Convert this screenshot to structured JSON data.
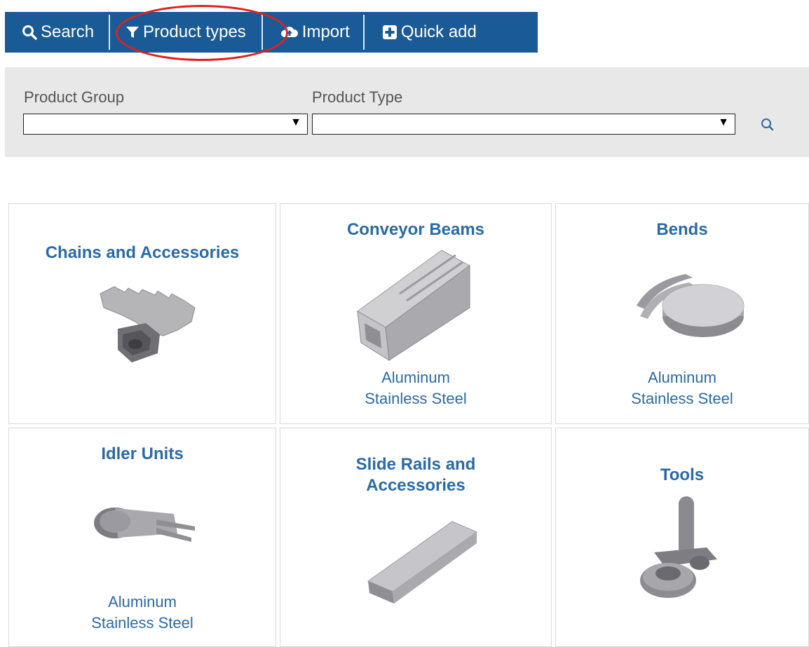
{
  "toolbar": {
    "search_label": "Search",
    "types_label": "Product types",
    "import_label": "Import",
    "quick_add_label": "Quick add",
    "bg_color": "#1a5a96",
    "highlight_color": "#e02020"
  },
  "filter": {
    "group_label": "Product Group",
    "group_value": "",
    "type_label": "Product Type",
    "type_value": ""
  },
  "tiles": [
    {
      "title": "Chains and Accessories",
      "sub1": "",
      "sub2": ""
    },
    {
      "title": "Conveyor Beams",
      "sub1": "Aluminum",
      "sub2": "Stainless Steel"
    },
    {
      "title": "Bends",
      "sub1": "Aluminum",
      "sub2": "Stainless Steel"
    },
    {
      "title": "Idler Units",
      "sub1": "Aluminum",
      "sub2": "Stainless Steel"
    },
    {
      "title": "Slide Rails and Accessories",
      "title_l1": "Slide Rails and",
      "title_l2": "Accessories",
      "sub1": "",
      "sub2": ""
    },
    {
      "title": "Tools",
      "sub1": "",
      "sub2": ""
    }
  ],
  "colors": {
    "link": "#2a6aa6",
    "panel": "#e8e8e8",
    "tile_border": "#d9d9d9"
  }
}
